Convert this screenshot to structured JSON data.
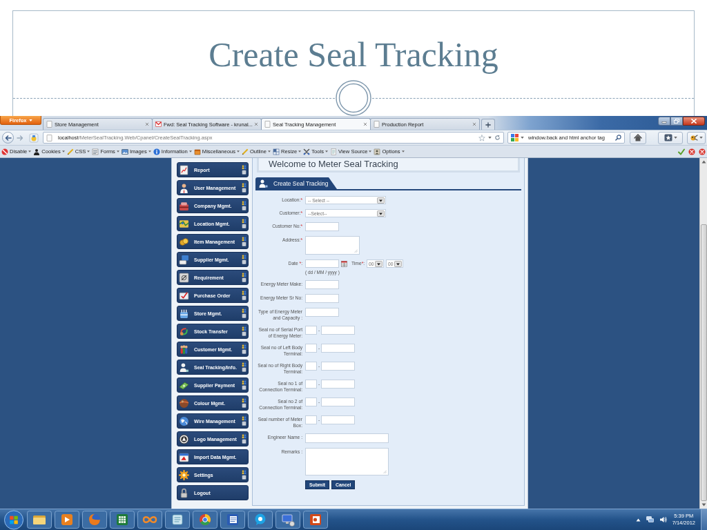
{
  "slide": {
    "title": "Create Seal Tracking"
  },
  "browser": {
    "menu_button": "Firefox",
    "tabs": [
      {
        "title": "Store Management",
        "selected": false
      },
      {
        "title": "Fwd: Seal Tracking Software - krunal...",
        "selected": false
      },
      {
        "title": "Seal Tracking Management",
        "selected": true
      },
      {
        "title": "Production Report",
        "selected": false
      }
    ],
    "address": {
      "host": "localhost",
      "path": "/MeterSealTracking.Web/Cpanel/CreateSealTracking.aspx"
    },
    "search": {
      "value": "window.back and html anchor tag"
    },
    "toolbar": [
      "Disable",
      "Cookies",
      "CSS",
      "Forms",
      "Images",
      "Information",
      "Miscellaneous",
      "Outline",
      "Resize",
      "Tools",
      "View Source",
      "Options"
    ]
  },
  "page": {
    "sidebar": [
      {
        "label": "Report",
        "shortcuts": true
      },
      {
        "label": "User Management",
        "shortcuts": true
      },
      {
        "label": "Company Mgmt.",
        "shortcuts": true
      },
      {
        "label": "Location Mgmt.",
        "shortcuts": true
      },
      {
        "label": "Item Management",
        "shortcuts": true
      },
      {
        "label": "Supplier Mgmt.",
        "shortcuts": true
      },
      {
        "label": "Requirement",
        "shortcuts": true
      },
      {
        "label": "Purchase Order",
        "shortcuts": true
      },
      {
        "label": "Store Mgmt.",
        "shortcuts": true
      },
      {
        "label": "Stock Transfer",
        "shortcuts": true
      },
      {
        "label": "Customer Mgmt.",
        "shortcuts": true
      },
      {
        "label": "Seal Tracking/Info.",
        "shortcuts": true
      },
      {
        "label": "Supplier Payment",
        "shortcuts": true
      },
      {
        "label": "Colour Mgmt.",
        "shortcuts": true
      },
      {
        "label": "Wire Management",
        "shortcuts": true
      },
      {
        "label": "Logo Management",
        "shortcuts": true
      },
      {
        "label": "Import Data Mgmt.",
        "shortcuts": false
      },
      {
        "label": "Settings",
        "shortcuts": true
      },
      {
        "label": "Logout",
        "shortcuts": false
      }
    ],
    "welcome": "Welcome to Meter Seal Tracking",
    "section_tab": "Create Seal Tracking",
    "form": {
      "fields": [
        {
          "kind": "select",
          "label": [
            {
              "text": "Location:",
              "required": false
            },
            {
              "text": "*",
              "required": true
            }
          ],
          "value": "-- Select --"
        },
        {
          "kind": "select",
          "label": [
            {
              "text": "Customer:",
              "required": false
            },
            {
              "text": "*",
              "required": true
            }
          ],
          "value": "--Select--"
        },
        {
          "kind": "text",
          "wide": false,
          "label": [
            {
              "text": "Customer No:",
              "required": false
            },
            {
              "text": "*",
              "required": true
            }
          ]
        },
        {
          "kind": "textarea",
          "wide": false,
          "label": [
            {
              "text": "Address:",
              "required": false
            },
            {
              "text": "*",
              "required": true
            }
          ]
        },
        {
          "kind": "date",
          "label": [
            {
              "text": "Date ",
              "required": false
            },
            {
              "text": "*",
              "required": true
            },
            {
              "text": ":",
              "required": false
            }
          ],
          "hint": "( dd / MM / yyyy )",
          "time": {
            "label": [
              {
                "text": "Time",
                "required": false
              },
              {
                "text": "*",
                "required": true
              },
              {
                "text": ":",
                "required": false
              }
            ],
            "hour": "00",
            "minute": "00"
          }
        },
        {
          "kind": "text",
          "wide": false,
          "label": [
            {
              "text": "Energy Meter Make:",
              "required": false
            }
          ]
        },
        {
          "kind": "text",
          "wide": false,
          "label": [
            {
              "text": "Energy Meter Sr No:",
              "required": false
            }
          ]
        },
        {
          "kind": "text",
          "wide": false,
          "label": [
            {
              "text": "Type of Energy Meter and Capacity :",
              "required": false
            }
          ]
        },
        {
          "kind": "pair",
          "separator": "-",
          "label": [
            {
              "text": "Seal no of Serial Port of Energy Meter:",
              "required": false
            }
          ]
        },
        {
          "kind": "pair",
          "separator": "-",
          "label": [
            {
              "text": "Seal no of Left Body Terminal:",
              "required": false
            }
          ]
        },
        {
          "kind": "pair",
          "separator": "-",
          "label": [
            {
              "text": "Seal no of Right Body Terminal:",
              "required": false
            }
          ]
        },
        {
          "kind": "pair",
          "separator": "-",
          "label": [
            {
              "text": "Seal no 1 of Connection Terminal:",
              "required": false
            }
          ]
        },
        {
          "kind": "pair",
          "separator": "-",
          "label": [
            {
              "text": "Seal no 2 of Connection Terminal:",
              "required": false
            }
          ]
        },
        {
          "kind": "pair",
          "separator": "-",
          "label": [
            {
              "text": "Seal number of Meter Box:",
              "required": false
            }
          ]
        },
        {
          "kind": "text",
          "wide": true,
          "label": [
            {
              "text": "Engineer Name :",
              "required": false
            }
          ]
        },
        {
          "kind": "textarea",
          "wide": true,
          "label": [
            {
              "text": "Remarks :",
              "required": false
            }
          ]
        }
      ],
      "buttons": [
        "Submit",
        "Cancel"
      ]
    }
  },
  "taskbar": {
    "time": "5:39 PM",
    "date": "7/14/2012"
  }
}
